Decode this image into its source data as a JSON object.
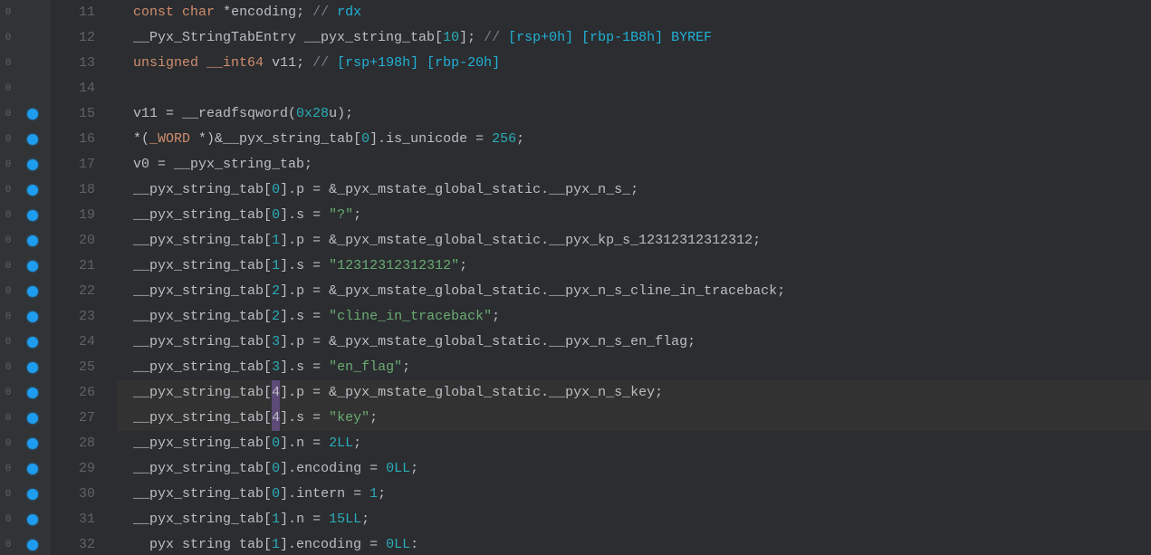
{
  "lines": [
    {
      "n": "11",
      "bp": false,
      "fold": "0",
      "segs": [
        {
          "t": "  ",
          "c": "tk-id"
        },
        {
          "t": "const",
          "c": "tk-kw"
        },
        {
          "t": " ",
          "c": "tk-id"
        },
        {
          "t": "char",
          "c": "tk-kw"
        },
        {
          "t": " *encoding; ",
          "c": "tk-id"
        },
        {
          "t": "// ",
          "c": "tk-cmt"
        },
        {
          "t": "rdx",
          "c": "tk-cmtkw"
        }
      ]
    },
    {
      "n": "12",
      "bp": false,
      "fold": "0",
      "segs": [
        {
          "t": "  __Pyx_StringTabEntry __pyx_string_tab[",
          "c": "tk-id"
        },
        {
          "t": "10",
          "c": "tk-num"
        },
        {
          "t": "]; ",
          "c": "tk-id"
        },
        {
          "t": "// ",
          "c": "tk-cmt"
        },
        {
          "t": "[rsp+0h] [rbp-1B8h] BYREF",
          "c": "tk-cmtkw"
        }
      ]
    },
    {
      "n": "13",
      "bp": false,
      "fold": "0",
      "segs": [
        {
          "t": "  ",
          "c": "tk-id"
        },
        {
          "t": "unsigned",
          "c": "tk-kw"
        },
        {
          "t": " ",
          "c": "tk-id"
        },
        {
          "t": "__int64",
          "c": "tk-kw"
        },
        {
          "t": " v11; ",
          "c": "tk-id"
        },
        {
          "t": "// ",
          "c": "tk-cmt"
        },
        {
          "t": "[rsp+198h] [rbp-20h]",
          "c": "tk-cmtkw"
        }
      ]
    },
    {
      "n": "14",
      "bp": false,
      "fold": "0",
      "segs": [
        {
          "t": "",
          "c": "tk-id"
        }
      ]
    },
    {
      "n": "15",
      "bp": true,
      "fold": "0",
      "segs": [
        {
          "t": "  v11 = __readfsqword(",
          "c": "tk-id"
        },
        {
          "t": "0x28",
          "c": "tk-num"
        },
        {
          "t": "u);",
          "c": "tk-id"
        }
      ]
    },
    {
      "n": "16",
      "bp": true,
      "fold": "0",
      "segs": [
        {
          "t": "  *(",
          "c": "tk-id"
        },
        {
          "t": "_WORD",
          "c": "tk-cast"
        },
        {
          "t": " *)&",
          "c": "tk-id"
        },
        {
          "t": "__pyx_string_tab",
          "c": "tk-id"
        },
        {
          "t": "[",
          "c": "tk-id"
        },
        {
          "t": "0",
          "c": "tk-num"
        },
        {
          "t": "].is_unicode = ",
          "c": "tk-id"
        },
        {
          "t": "256",
          "c": "tk-num"
        },
        {
          "t": ";",
          "c": "tk-id"
        }
      ]
    },
    {
      "n": "17",
      "bp": true,
      "fold": "0",
      "segs": [
        {
          "t": "  v0 = ",
          "c": "tk-id"
        },
        {
          "t": "__pyx_string_tab",
          "c": "tk-id"
        },
        {
          "t": ";",
          "c": "tk-id"
        }
      ]
    },
    {
      "n": "18",
      "bp": true,
      "fold": "0",
      "segs": [
        {
          "t": "  ",
          "c": "tk-id"
        },
        {
          "t": "__pyx_string_tab",
          "c": "tk-id"
        },
        {
          "t": "[",
          "c": "tk-id"
        },
        {
          "t": "0",
          "c": "tk-num"
        },
        {
          "t": "].p = &",
          "c": "tk-id"
        },
        {
          "t": "_pyx_mstate_global_static",
          "c": "tk-fn"
        },
        {
          "t": ".__pyx_n_s_;",
          "c": "tk-id"
        }
      ]
    },
    {
      "n": "19",
      "bp": true,
      "fold": "0",
      "segs": [
        {
          "t": "  ",
          "c": "tk-id"
        },
        {
          "t": "__pyx_string_tab",
          "c": "tk-id"
        },
        {
          "t": "[",
          "c": "tk-id"
        },
        {
          "t": "0",
          "c": "tk-num"
        },
        {
          "t": "].s = ",
          "c": "tk-id"
        },
        {
          "t": "\"?\"",
          "c": "tk-str"
        },
        {
          "t": ";",
          "c": "tk-id"
        }
      ]
    },
    {
      "n": "20",
      "bp": true,
      "fold": "0",
      "segs": [
        {
          "t": "  ",
          "c": "tk-id"
        },
        {
          "t": "__pyx_string_tab",
          "c": "tk-id"
        },
        {
          "t": "[",
          "c": "tk-id"
        },
        {
          "t": "1",
          "c": "tk-num"
        },
        {
          "t": "].p = &",
          "c": "tk-id"
        },
        {
          "t": "_pyx_mstate_global_static",
          "c": "tk-fn"
        },
        {
          "t": ".__pyx_kp_s_12312312312312;",
          "c": "tk-id"
        }
      ]
    },
    {
      "n": "21",
      "bp": true,
      "fold": "0",
      "segs": [
        {
          "t": "  ",
          "c": "tk-id"
        },
        {
          "t": "__pyx_string_tab",
          "c": "tk-id"
        },
        {
          "t": "[",
          "c": "tk-id"
        },
        {
          "t": "1",
          "c": "tk-num"
        },
        {
          "t": "].s = ",
          "c": "tk-id"
        },
        {
          "t": "\"12312312312312\"",
          "c": "tk-str"
        },
        {
          "t": ";",
          "c": "tk-id"
        }
      ]
    },
    {
      "n": "22",
      "bp": true,
      "fold": "0",
      "segs": [
        {
          "t": "  ",
          "c": "tk-id"
        },
        {
          "t": "__pyx_string_tab",
          "c": "tk-id"
        },
        {
          "t": "[",
          "c": "tk-id"
        },
        {
          "t": "2",
          "c": "tk-num"
        },
        {
          "t": "].p = &",
          "c": "tk-id"
        },
        {
          "t": "_pyx_mstate_global_static",
          "c": "tk-fn"
        },
        {
          "t": ".__pyx_n_s_cline_in_traceback;",
          "c": "tk-id"
        }
      ]
    },
    {
      "n": "23",
      "bp": true,
      "fold": "0",
      "segs": [
        {
          "t": "  ",
          "c": "tk-id"
        },
        {
          "t": "__pyx_string_tab",
          "c": "tk-id"
        },
        {
          "t": "[",
          "c": "tk-id"
        },
        {
          "t": "2",
          "c": "tk-num"
        },
        {
          "t": "].s = ",
          "c": "tk-id"
        },
        {
          "t": "\"cline_in_traceback\"",
          "c": "tk-str"
        },
        {
          "t": ";",
          "c": "tk-id"
        }
      ]
    },
    {
      "n": "24",
      "bp": true,
      "fold": "0",
      "segs": [
        {
          "t": "  ",
          "c": "tk-id"
        },
        {
          "t": "__pyx_string_tab",
          "c": "tk-id"
        },
        {
          "t": "[",
          "c": "tk-id"
        },
        {
          "t": "3",
          "c": "tk-num"
        },
        {
          "t": "].p = &",
          "c": "tk-id"
        },
        {
          "t": "_pyx_mstate_global_static",
          "c": "tk-fn"
        },
        {
          "t": ".__pyx_n_s_en_flag;",
          "c": "tk-id"
        }
      ]
    },
    {
      "n": "25",
      "bp": true,
      "fold": "0",
      "segs": [
        {
          "t": "  ",
          "c": "tk-id"
        },
        {
          "t": "__pyx_string_tab",
          "c": "tk-id"
        },
        {
          "t": "[",
          "c": "tk-id"
        },
        {
          "t": "3",
          "c": "tk-num"
        },
        {
          "t": "].s = ",
          "c": "tk-id"
        },
        {
          "t": "\"en_flag\"",
          "c": "tk-str"
        },
        {
          "t": ";",
          "c": "tk-id"
        }
      ]
    },
    {
      "n": "26",
      "bp": true,
      "fold": "0",
      "cur": true,
      "segs": [
        {
          "t": "  ",
          "c": "tk-id"
        },
        {
          "t": "__pyx_string_tab",
          "c": "tk-id"
        },
        {
          "t": "[",
          "c": "tk-id"
        },
        {
          "t": "4",
          "c": "tk-hl"
        },
        {
          "t": "].p = &",
          "c": "tk-id"
        },
        {
          "t": "_pyx_mstate_global_static",
          "c": "tk-fn"
        },
        {
          "t": ".__pyx_n_s_key;",
          "c": "tk-id"
        }
      ]
    },
    {
      "n": "27",
      "bp": true,
      "fold": "0",
      "cur": true,
      "segs": [
        {
          "t": "  ",
          "c": "tk-id"
        },
        {
          "t": "__pyx_string_tab",
          "c": "tk-id"
        },
        {
          "t": "[",
          "c": "tk-id"
        },
        {
          "t": "4",
          "c": "tk-hl"
        },
        {
          "t": "].s = ",
          "c": "tk-id"
        },
        {
          "t": "\"key\"",
          "c": "tk-str"
        },
        {
          "t": ";",
          "c": "tk-id"
        }
      ]
    },
    {
      "n": "28",
      "bp": true,
      "fold": "0",
      "segs": [
        {
          "t": "  ",
          "c": "tk-id"
        },
        {
          "t": "__pyx_string_tab",
          "c": "tk-id"
        },
        {
          "t": "[",
          "c": "tk-id"
        },
        {
          "t": "0",
          "c": "tk-num"
        },
        {
          "t": "].n = ",
          "c": "tk-id"
        },
        {
          "t": "2LL",
          "c": "tk-num"
        },
        {
          "t": ";",
          "c": "tk-id"
        }
      ]
    },
    {
      "n": "29",
      "bp": true,
      "fold": "0",
      "segs": [
        {
          "t": "  ",
          "c": "tk-id"
        },
        {
          "t": "__pyx_string_tab",
          "c": "tk-id"
        },
        {
          "t": "[",
          "c": "tk-id"
        },
        {
          "t": "0",
          "c": "tk-num"
        },
        {
          "t": "].encoding = ",
          "c": "tk-id"
        },
        {
          "t": "0LL",
          "c": "tk-num"
        },
        {
          "t": ";",
          "c": "tk-id"
        }
      ]
    },
    {
      "n": "30",
      "bp": true,
      "fold": "0",
      "segs": [
        {
          "t": "  ",
          "c": "tk-id"
        },
        {
          "t": "__pyx_string_tab",
          "c": "tk-id"
        },
        {
          "t": "[",
          "c": "tk-id"
        },
        {
          "t": "0",
          "c": "tk-num"
        },
        {
          "t": "].intern = ",
          "c": "tk-id"
        },
        {
          "t": "1",
          "c": "tk-num"
        },
        {
          "t": ";",
          "c": "tk-id"
        }
      ]
    },
    {
      "n": "31",
      "bp": true,
      "fold": "0",
      "segs": [
        {
          "t": "  ",
          "c": "tk-id"
        },
        {
          "t": "__pyx_string_tab",
          "c": "tk-id"
        },
        {
          "t": "[",
          "c": "tk-id"
        },
        {
          "t": "1",
          "c": "tk-num"
        },
        {
          "t": "].n = ",
          "c": "tk-id"
        },
        {
          "t": "15LL",
          "c": "tk-num"
        },
        {
          "t": ";",
          "c": "tk-id"
        }
      ]
    },
    {
      "n": "32",
      "bp": true,
      "fold": "0",
      "segs": [
        {
          "t": "    pyx string tab[",
          "c": "tk-id"
        },
        {
          "t": "1",
          "c": "tk-num"
        },
        {
          "t": "].encoding = ",
          "c": "tk-id"
        },
        {
          "t": "0LL",
          "c": "tk-num"
        },
        {
          "t": ":",
          "c": "tk-id"
        }
      ]
    }
  ]
}
